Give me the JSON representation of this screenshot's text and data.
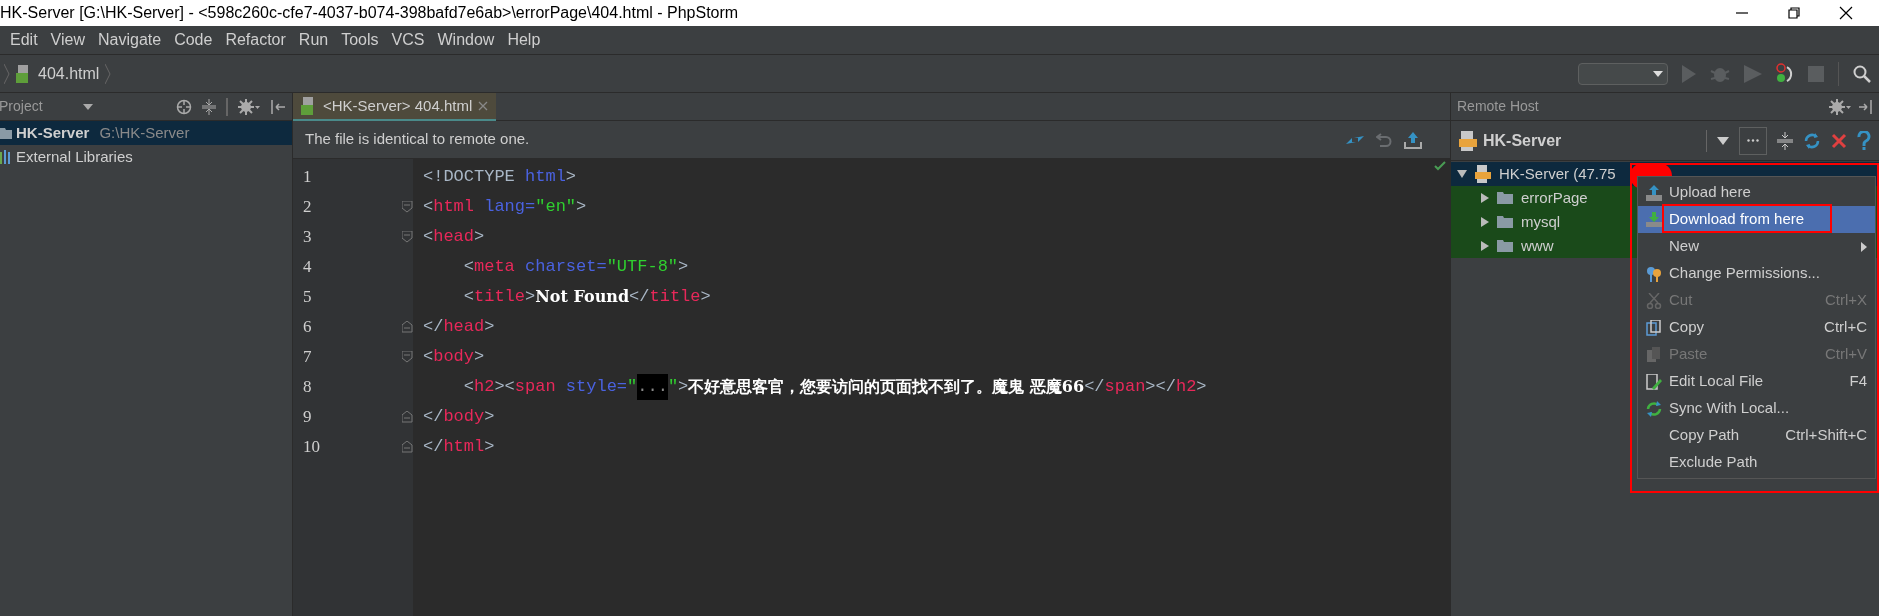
{
  "window": {
    "title": "HK-Server [G:\\HK-Server] - <598c260c-cfe7-4037-b074-398bafd7e6ab>\\errorPage\\404.html - PhpStorm"
  },
  "menu_bar": [
    "Edit",
    "View",
    "Navigate",
    "Code",
    "Refactor",
    "Run",
    "Tools",
    "VCS",
    "Window",
    "Help"
  ],
  "breadcrumb": "404.html",
  "project_panel": {
    "title": "Project",
    "items": [
      {
        "name": "HK-Server",
        "path": "G:\\HK-Server",
        "selected": true,
        "kind": "folder"
      },
      {
        "name": "External Libraries",
        "selected": false,
        "kind": "library"
      }
    ]
  },
  "editor": {
    "tabs": [
      {
        "label": "<HK-Server> 404.html",
        "selected": true
      }
    ],
    "notification": "The file is identical to remote one.",
    "lines": [
      {
        "number": "1",
        "kind": "plain",
        "tokens": [
          {
            "kind": "punct",
            "text": "<!DOCTYPE "
          },
          {
            "kind": "attr",
            "text": "html"
          },
          {
            "kind": "punct",
            "text": ">"
          }
        ]
      },
      {
        "number": "2",
        "kind": "fold-start",
        "tokens": [
          {
            "kind": "punct",
            "text": "<"
          },
          {
            "kind": "tag",
            "text": "html "
          },
          {
            "kind": "attr",
            "text": "lang="
          },
          {
            "kind": "string",
            "text": "\"en\""
          },
          {
            "kind": "punct",
            "text": ">"
          }
        ]
      },
      {
        "number": "3",
        "kind": "fold-start",
        "tokens": [
          {
            "kind": "punct",
            "text": "<"
          },
          {
            "kind": "tag",
            "text": "head"
          },
          {
            "kind": "punct",
            "text": ">"
          }
        ]
      },
      {
        "number": "4",
        "kind": "plain",
        "tokens": [
          {
            "kind": "punct",
            "text": "    <"
          },
          {
            "kind": "tag",
            "text": "meta "
          },
          {
            "kind": "attr",
            "text": "charset="
          },
          {
            "kind": "string",
            "text": "\"UTF-8\""
          },
          {
            "kind": "punct",
            "text": ">"
          }
        ]
      },
      {
        "number": "5",
        "kind": "plain",
        "tokens": [
          {
            "kind": "punct",
            "text": "    <"
          },
          {
            "kind": "tag",
            "text": "title"
          },
          {
            "kind": "punct",
            "text": ">"
          },
          {
            "kind": "text",
            "text": "Not Found"
          },
          {
            "kind": "punct",
            "text": "</"
          },
          {
            "kind": "tag",
            "text": "title"
          },
          {
            "kind": "punct",
            "text": ">"
          }
        ]
      },
      {
        "number": "6",
        "kind": "fold-end",
        "tokens": [
          {
            "kind": "punct",
            "text": "</"
          },
          {
            "kind": "tag",
            "text": "head"
          },
          {
            "kind": "punct",
            "text": ">"
          }
        ]
      },
      {
        "number": "7",
        "kind": "fold-start",
        "tokens": [
          {
            "kind": "punct",
            "text": "<"
          },
          {
            "kind": "tag",
            "text": "body"
          },
          {
            "kind": "punct",
            "text": ">"
          }
        ]
      },
      {
        "number": "8",
        "kind": "plain",
        "tokens": [
          {
            "kind": "punct",
            "text": "    <"
          },
          {
            "kind": "tag",
            "text": "h2"
          },
          {
            "kind": "punct",
            "text": "><"
          },
          {
            "kind": "tag",
            "text": "span "
          },
          {
            "kind": "attr",
            "text": "style="
          },
          {
            "kind": "string",
            "text": "\""
          },
          {
            "kind": "folded",
            "text": "..."
          },
          {
            "kind": "string",
            "text": "\""
          },
          {
            "kind": "punct",
            "text": ">"
          },
          {
            "kind": "text",
            "text": "不好意思客官，您要访问的页面找不到了。魔鬼 恶魔66"
          },
          {
            "kind": "punct",
            "text": "</"
          },
          {
            "kind": "tag",
            "text": "span"
          },
          {
            "kind": "punct",
            "text": "></"
          },
          {
            "kind": "tag",
            "text": "h2"
          },
          {
            "kind": "punct",
            "text": ">"
          }
        ]
      },
      {
        "number": "9",
        "kind": "fold-end",
        "tokens": [
          {
            "kind": "punct",
            "text": "</"
          },
          {
            "kind": "tag",
            "text": "body"
          },
          {
            "kind": "punct",
            "text": ">"
          }
        ]
      },
      {
        "number": "10",
        "kind": "fold-end",
        "tokens": [
          {
            "kind": "punct",
            "text": "</"
          },
          {
            "kind": "tag",
            "text": "html"
          },
          {
            "kind": "punct",
            "text": ">"
          }
        ]
      }
    ]
  },
  "remote_host": {
    "title": "Remote Host",
    "server": "HK-Server",
    "tree": [
      {
        "label": "HK-Server (47.75",
        "expanded": true,
        "selected": true,
        "kind": "server",
        "children": [
          {
            "label": "errorPage",
            "expanded": false,
            "selected": false,
            "kind": "folder"
          },
          {
            "label": "mysql",
            "expanded": false,
            "selected": false,
            "kind": "folder"
          },
          {
            "label": "www",
            "expanded": false,
            "selected": false,
            "kind": "folder"
          }
        ]
      }
    ]
  },
  "context_menu": [
    {
      "label": "Upload here",
      "kind": "upload",
      "disabled": false,
      "selected": false
    },
    {
      "label": "Download from here",
      "kind": "download",
      "disabled": false,
      "selected": true
    },
    {
      "label": "New",
      "kind": "plain",
      "disabled": false,
      "selected": false,
      "submenu": true
    },
    {
      "label": "Change Permissions...",
      "kind": "keys",
      "disabled": false,
      "selected": false
    },
    {
      "label": "Cut",
      "shortcut": "Ctrl+X",
      "kind": "cut",
      "disabled": true,
      "selected": false
    },
    {
      "label": "Copy",
      "shortcut": "Ctrl+C",
      "kind": "copy",
      "disabled": false,
      "selected": false
    },
    {
      "label": "Paste",
      "shortcut": "Ctrl+V",
      "kind": "paste",
      "disabled": true,
      "selected": false
    },
    {
      "label": "Edit Local File",
      "shortcut": "F4",
      "kind": "edit",
      "disabled": false,
      "selected": false
    },
    {
      "label": "Sync With Local...",
      "kind": "sync",
      "disabled": false,
      "selected": false
    },
    {
      "label": "Copy Path",
      "shortcut": "Ctrl+Shift+C",
      "kind": "plain",
      "disabled": false,
      "selected": false
    },
    {
      "label": "Exclude Path",
      "kind": "plain",
      "disabled": false,
      "selected": false
    }
  ]
}
